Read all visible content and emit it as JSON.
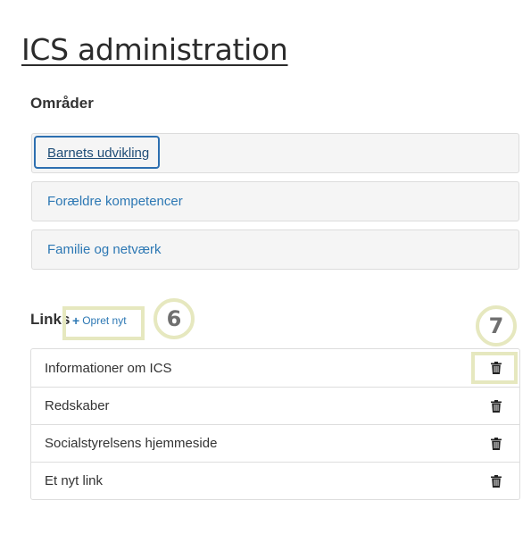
{
  "page": {
    "title": "ICS administration"
  },
  "areas": {
    "heading": "Områder",
    "items": [
      {
        "label": "Barnets udvikling",
        "active": true
      },
      {
        "label": "Forældre kompetencer",
        "active": false
      },
      {
        "label": "Familie og netværk",
        "active": false
      }
    ]
  },
  "links": {
    "heading": "Links",
    "create_label": "Opret nyt",
    "create_icon": "plus-icon",
    "delete_icon": "trash-icon",
    "rows": [
      {
        "label": "Informationer om ICS"
      },
      {
        "label": "Redskaber"
      },
      {
        "label": "Socialstyrelsens hjemmeside"
      },
      {
        "label": "Et nyt link"
      }
    ]
  },
  "callouts": {
    "create": "6",
    "delete": "7"
  },
  "colors": {
    "link": "#2d78b4",
    "highlight": "#e6e8bf",
    "active_border": "#2d6fb0"
  }
}
